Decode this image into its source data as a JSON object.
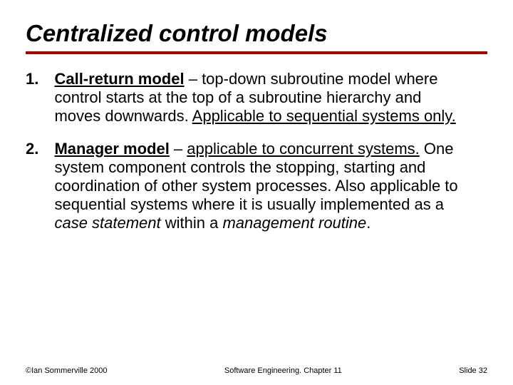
{
  "title": "Centralized control models",
  "items": [
    {
      "num": "1.",
      "head": "Call-return model",
      "dash": " – ",
      "t1": "top-down subroutine model where control starts at the top of a subroutine hierarchy and moves downwards. ",
      "t2": "Applicable to sequential systems only.",
      "t3": "",
      "t4": "",
      "t5": "",
      "t6": "",
      "t7": "",
      "t8": ""
    },
    {
      "num": "2.",
      "head": "Manager model",
      "dash": " – ",
      "t1": "",
      "t2": "applicable to concurrent systems.",
      "t3": "  One system component controls the stopping, starting and coordination of other system processes. Also applicable to sequential systems where it is usually implemented as a ",
      "t4": "case statement",
      "t5": " within a ",
      "t6": "management routine",
      "t7": ".",
      "t8": ""
    }
  ],
  "footer": {
    "left": "©Ian Sommerville 2000",
    "center": "Software Engineering. Chapter 11",
    "right": "Slide 32"
  }
}
